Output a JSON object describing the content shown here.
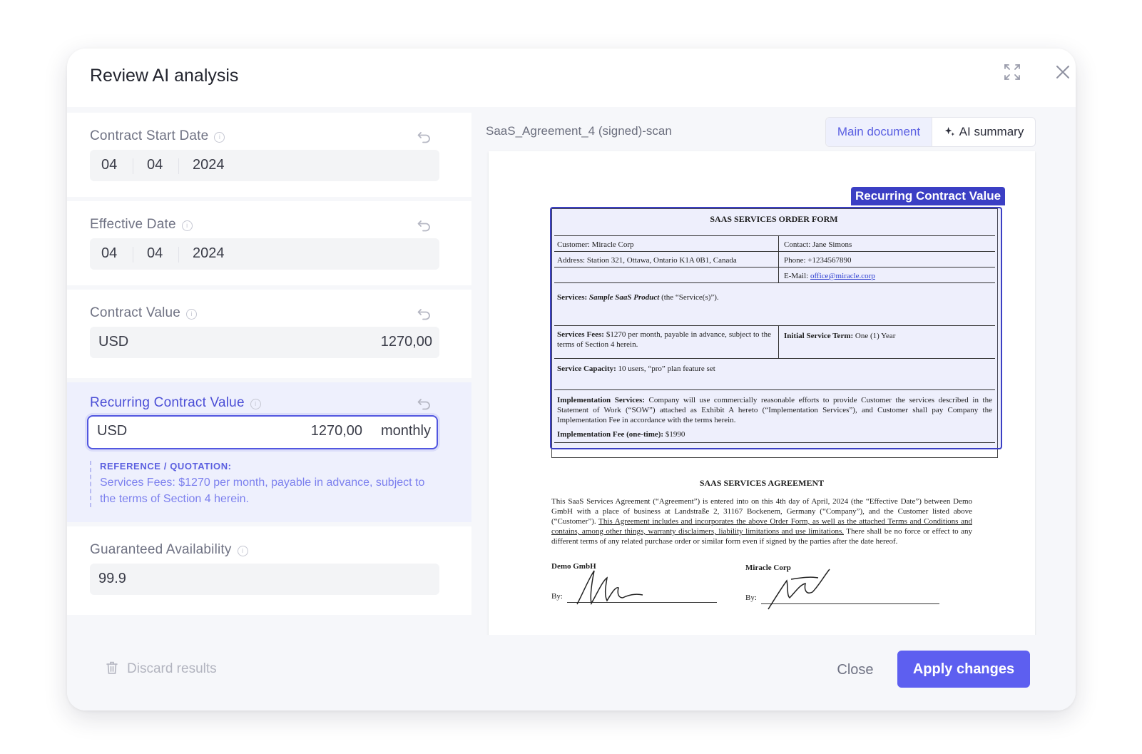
{
  "modal": {
    "title": "Review AI analysis",
    "icons": {
      "expand": "expand-icon",
      "close": "close-icon"
    }
  },
  "fields": {
    "contract_start": {
      "label": "Contract Start Date",
      "day": "04",
      "month": "04",
      "year": "2024"
    },
    "effective": {
      "label": "Effective Date",
      "day": "04",
      "month": "04",
      "year": "2024"
    },
    "contract_value": {
      "label": "Contract Value",
      "currency": "USD",
      "amount": "1270,00"
    },
    "recurring": {
      "label": "Recurring Contract Value",
      "currency": "USD",
      "amount": "1270,00",
      "period": "monthly",
      "reference_title": "REFERENCE / QUOTATION:",
      "reference_text": "Services Fees: $1270 per month, payable in advance, subject to the terms of Section 4 herein."
    },
    "availability": {
      "label": "Guaranteed Availability",
      "value": "99.9"
    }
  },
  "viewer": {
    "file_name": "SaaS_Agreement_4 (signed)-scan",
    "tabs": {
      "main": "Main document",
      "ai": "AI summary"
    },
    "highlight_label": "Recurring Contract Value",
    "document": {
      "order_form_title": "SAAS SERVICES ORDER FORM",
      "customer": "Customer: Miracle Corp",
      "address": "Address: Station 321, Ottawa, Ontario K1A 0B1, Canada",
      "contact": "Contact: Jane Simons",
      "phone": "Phone: +1234567890",
      "email_label": "E-Mail: ",
      "email": "office@miracle.corp",
      "services_label": "Services:",
      "services_product": "Sample SaaS Product",
      "services_rest": "(the “Service(s)”).",
      "fees_label": "Services Fees:",
      "fees_text": "$1270 per month, payable in advance, subject to the terms of Section 4 herein.",
      "term_label": "Initial Service Term:",
      "term_text": "One (1) Year",
      "capacity_label": "Service Capacity:",
      "capacity_text": "10 users, “pro” plan feature set",
      "impl_label": "Implementation Services:",
      "impl_text": "Company will use commercially reasonable efforts to provide Customer the services described in the Statement of Work (“SOW”) attached as Exhibit A hereto (“Implementation Services”), and Customer shall pay Company the Implementation Fee in accordance with the terms herein.",
      "impl_fee_label": "Implementation Fee (one-time):",
      "impl_fee_text": "$1990",
      "agreement_title": "SAAS SERVICES AGREEMENT",
      "agreement_p1": "This SaaS Services Agreement (“Agreement”) is entered into on this 4th day of April, 2024 (the “Effective Date”) between Demo GmbH with a place of business at Landstraße 2, 31167 Bockenem, Germany (“Company”), and the Customer listed above (“Customer”).",
      "agreement_p2": "This Agreement includes and incorporates the above Order Form, as well as the attached Terms and Conditions and contains, among other things, warranty disclaimers, liability limitations and use limitations.",
      "agreement_p3": "There shall be no force or effect to any different terms of any related purchase order or similar form even if signed by the parties after the date hereof.",
      "party1": "Demo GmbH",
      "party2": "Miracle Corp",
      "by": "By:"
    }
  },
  "footer": {
    "discard": "Discard results",
    "close": "Close",
    "apply": "Apply changes"
  },
  "colors": {
    "accent": "#5d5ff0",
    "highlight": "#3b3fc4",
    "active_bg": "#eef0fd"
  }
}
